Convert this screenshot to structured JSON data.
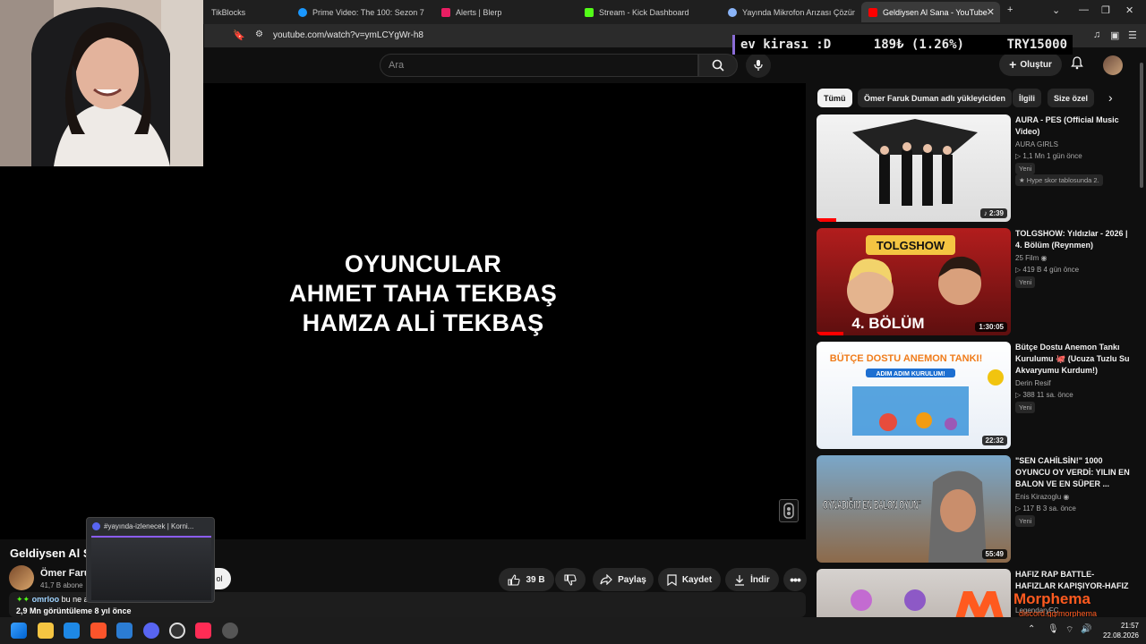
{
  "browser": {
    "tabs": [
      {
        "label": "TikBlocks",
        "color": "#4fc3f7"
      },
      {
        "label": "Prime Video: The 100: Sezon 7",
        "color": "#1a98ff"
      },
      {
        "label": "Alerts | Blerp",
        "color": "#e91e63"
      },
      {
        "label": "Stream - Kick Dashboard",
        "color": "#53fc18"
      },
      {
        "label": "Yayında Mikrofon Arızası Çözümü",
        "color": "#8ab4f8"
      },
      {
        "label": "Geldiysen Al Sana - YouTube",
        "color": "#ff0000"
      }
    ],
    "new_tab": "+",
    "url": "youtube.com/watch?v=ymLCYgWr-h8"
  },
  "ticker": {
    "left": "ev kirası :D",
    "mid": "189₺ (1.26%)",
    "right": "TRY15000"
  },
  "header": {
    "search_placeholder": "Ara",
    "create_label": "Oluştur"
  },
  "player": {
    "credits": [
      "OYUNCULAR",
      "AHMET TAHA TEKBAŞ",
      "HAMZA ALİ TEKBAŞ"
    ]
  },
  "video": {
    "title": "Geldiysen Al S",
    "channel": "Ömer Faruk",
    "subs": "41,7 B abone",
    "join_label": "ol",
    "chat_user": "omrloo",
    "chat_msg": "bu ne a",
    "views": "2,9 Mn görüntüleme  8 yıl önce",
    "actions": {
      "likes": "39 B",
      "share": "Paylaş",
      "save": "Kaydet",
      "download": "İndir"
    }
  },
  "discord_preview": {
    "title": "#yayında-izlenecek | Korni..."
  },
  "sidebar": {
    "chips": [
      "Tümü",
      "Ömer Faruk Duman adlı yükleyiciden",
      "İlgili",
      "Size özel"
    ],
    "recs": [
      {
        "title": "AURA - PES (Official Music Video)",
        "channel": "AURA GIRLS",
        "meta": "▷ 1,1 Mn  1 gün önce",
        "badge": "Yeni",
        "extra": "★ Hype skor tablosunda 2.",
        "duration": "♪ 2:39"
      },
      {
        "title": "TOLGSHOW: Yıldızlar - 2026 | 4. Bölüm (Reynmen)",
        "channel": "25 Film ◉",
        "meta": "▷ 419 B  4 gün önce",
        "badge": "Yeni",
        "duration": "1:30:05",
        "thumb_text": "4. BÖLÜM",
        "thumb_top": "TOLGSHOW"
      },
      {
        "title": "Bütçe Dostu Anemon Tankı Kurulumu 🐙 (Ucuza Tuzlu Su Akvaryumu Kurdum!)",
        "channel": "Derin Resif",
        "meta": "▷ 388  11 sa. önce",
        "badge": "Yeni",
        "duration": "22:32",
        "thumb_text": "BÜTÇE DOSTU ANEMON TANKI!",
        "thumb_sub": "ADIM ADIM KURULUM!"
      },
      {
        "title": "\"SEN CAHİLSİN!\" 1000 OYUNCU OY VERDİ: YILIN EN BALON VE EN SÜPER ...",
        "channel": "Enis Kirazoglu ◉",
        "meta": "▷ 117 B  3 sa. önce",
        "badge": "Yeni",
        "duration": "55:49",
        "thumb_text": "OYNADIĞIM EN BALON OYUN\""
      },
      {
        "title": "HAFIZ RAP BATTLE-HAFIZLAR KAPIŞIYOR-HAFIZ",
        "channel": "LegendaryFC"
      }
    ]
  },
  "overlay": {
    "brand": "Morphema",
    "sub": "discord.gg/morphema"
  },
  "taskbar": {
    "time": "21:57",
    "date": "22.08.2026"
  },
  "colors": {
    "accent_red": "#ff0000",
    "morphema_orange": "#ff5a1f",
    "chip_bg": "#272727"
  }
}
